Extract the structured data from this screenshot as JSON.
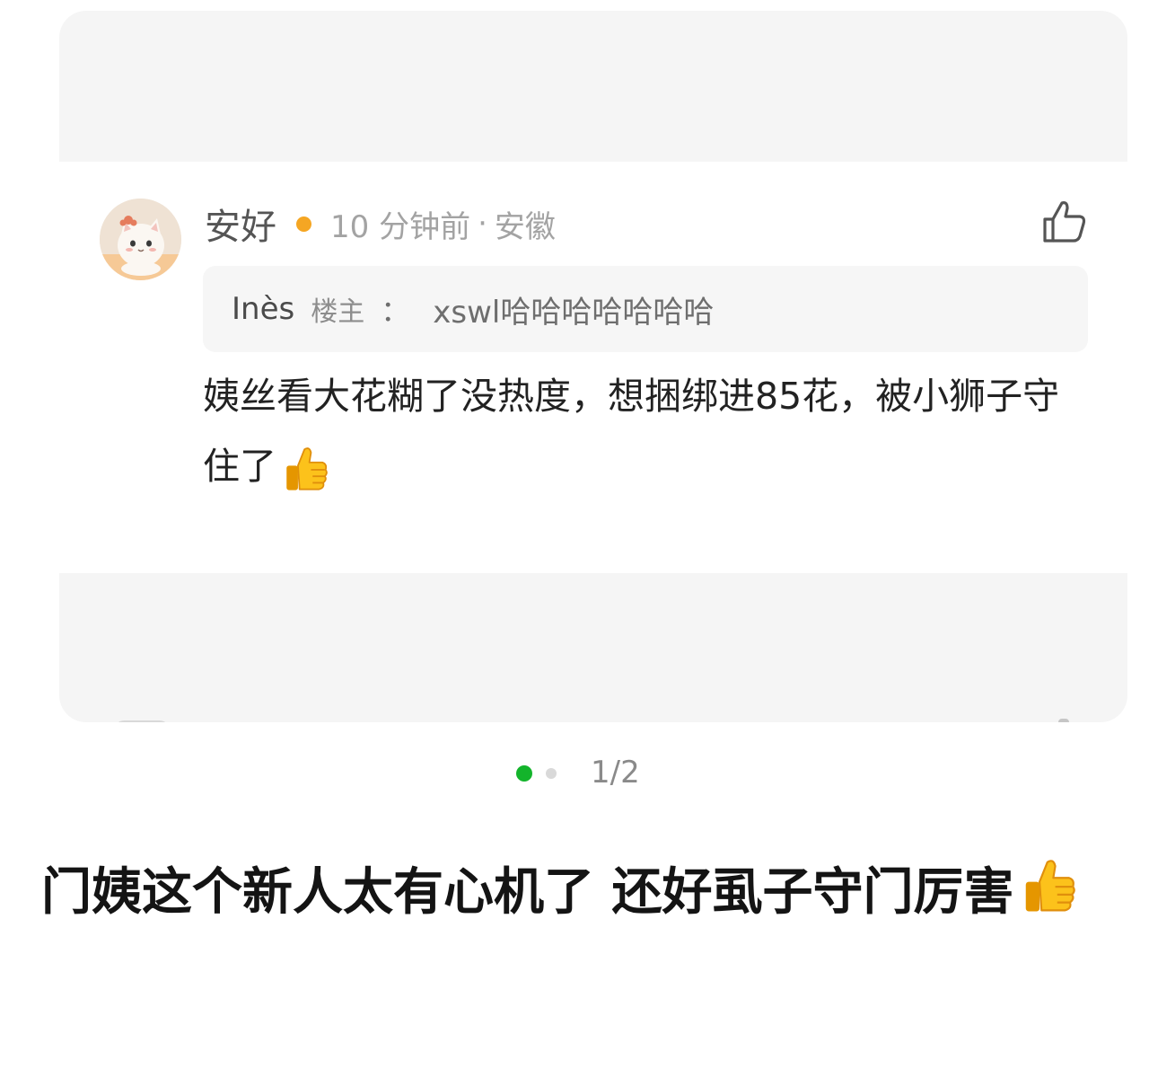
{
  "comment": {
    "username": "安好",
    "time": "10 分钟前",
    "separator": "·",
    "location": "安徽",
    "avatar_icon": "cat-avatar",
    "like_icon": "thumbs-up-outline-icon",
    "quote": {
      "user": "Inès",
      "badge": "楼主",
      "colon": "：",
      "text": "xswl哈哈哈哈哈哈哈"
    },
    "body": "姨丝看大花糊了没热度，想捆绑进85花，被小狮子守住了",
    "body_emoji": "thumbs-up-emoji"
  },
  "pager": {
    "indicator": "1/2",
    "active_color": "#13b42b"
  },
  "caption": {
    "text": "门姨这个新人太有心机了 还好虱子守门厉害",
    "emoji": "thumbs-up-emoji"
  },
  "colors": {
    "level_dot": "#f5a623",
    "card_background": "#f5f5f5"
  }
}
